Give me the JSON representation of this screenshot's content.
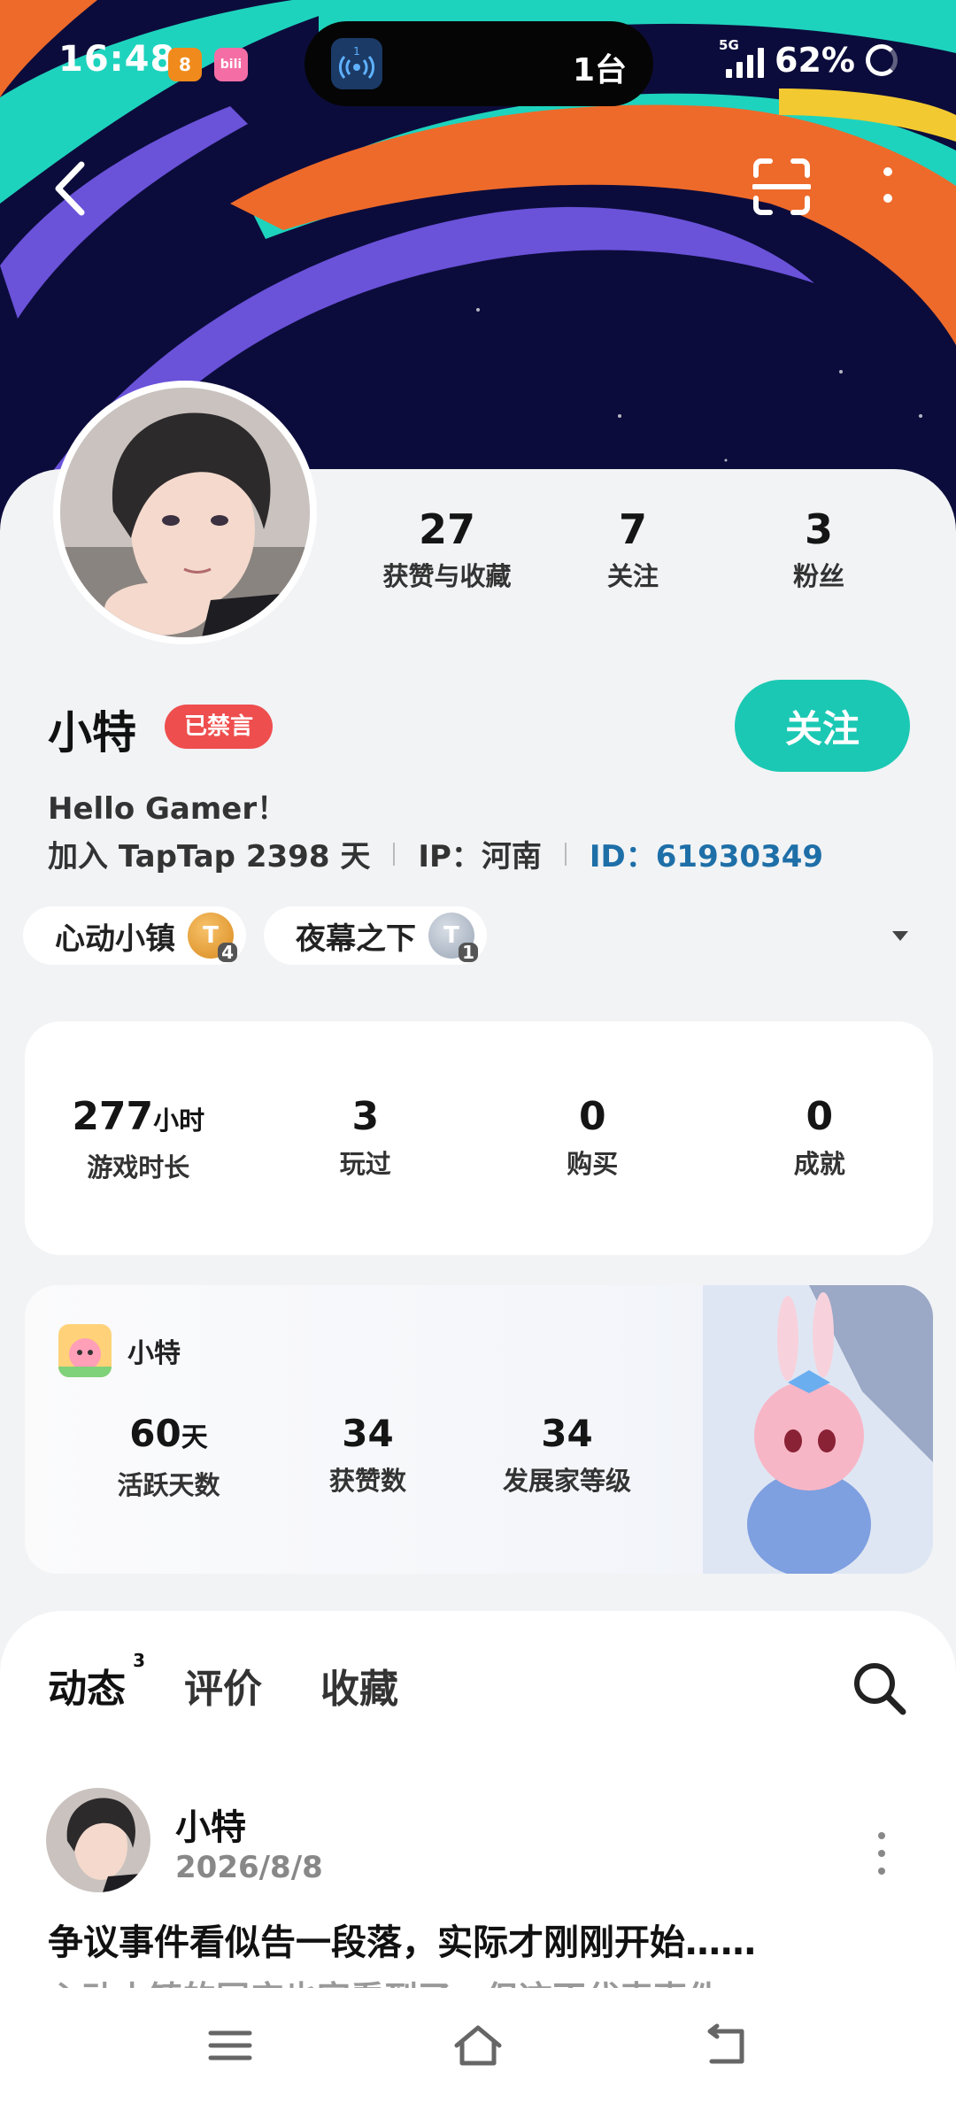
{
  "status_bar": {
    "time": "16:48",
    "app_chip_1": "8",
    "app_chip_2": "bili",
    "island_app_num": "1",
    "island_text": "1台",
    "network": "5G",
    "battery": "62%"
  },
  "profile": {
    "likes_count": "27",
    "likes_label": "获赞与收藏",
    "following_count": "7",
    "following_label": "关注",
    "followers_count": "3",
    "followers_label": "粉丝",
    "name": "小特",
    "banned_badge": "已禁言",
    "follow_label": "关注",
    "bio": "Hello Gamer！",
    "joined": "加入 TapTap 2398 天",
    "ip": "IP：河南",
    "uid": "ID：61930349"
  },
  "tags": [
    {
      "label": "心动小镇",
      "level": "4",
      "badge": "T"
    },
    {
      "label": "夜幕之下",
      "level": "1",
      "badge": "T"
    }
  ],
  "game_stats": {
    "playtime_value": "277",
    "playtime_unit": "小时",
    "playtime_label": "游戏时长",
    "played_value": "3",
    "played_label": "玩过",
    "bought_value": "0",
    "bought_label": "购买",
    "achievements_value": "0",
    "achievements_label": "成就"
  },
  "game_card": {
    "user": "小特",
    "active_days_value": "60",
    "active_days_unit": "天",
    "active_days_label": "活跃天数",
    "likes_value": "34",
    "likes_label": "获赞数",
    "dev_level_value": "34",
    "dev_level_label": "发展家等级"
  },
  "feed": {
    "tabs": [
      {
        "label": "动态",
        "count": "3"
      },
      {
        "label": "评价"
      },
      {
        "label": "收藏"
      }
    ],
    "post": {
      "author": "小特",
      "date": "2026/8/8",
      "title": "争议事件看似告一段落，实际才刚刚开始……",
      "preview": "心动小镇的同床也容看到了，但这不代表事件"
    }
  },
  "colors": {
    "accent": "#1bc8b3",
    "banned": "#ef4e4e",
    "uid": "#1e6fa8",
    "banner_bg": "#0c0c3c"
  }
}
